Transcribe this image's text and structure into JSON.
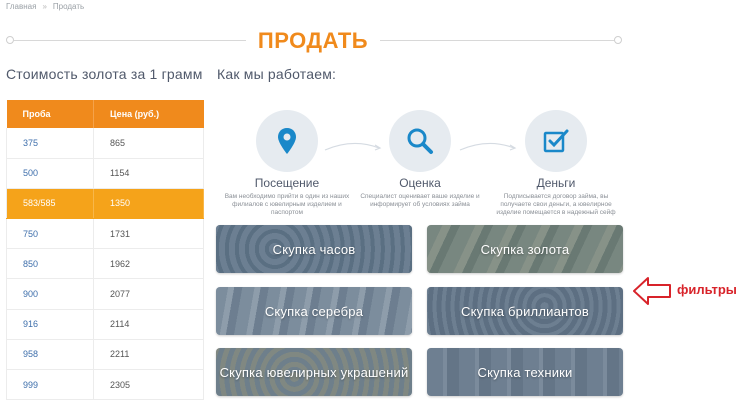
{
  "breadcrumb": {
    "home": "Главная",
    "separator": "»",
    "current": "Продать"
  },
  "page": {
    "title": "ПРОДАТЬ"
  },
  "gold_table": {
    "heading": "Стоимость золота за 1 грамм",
    "columns": [
      "Проба",
      "Цена (руб.)"
    ],
    "rows": [
      {
        "probe": "375",
        "price": "865"
      },
      {
        "probe": "500",
        "price": "1154"
      },
      {
        "probe": "583/585",
        "price": "1350",
        "highlighted": true
      },
      {
        "probe": "750",
        "price": "1731"
      },
      {
        "probe": "850",
        "price": "1962"
      },
      {
        "probe": "900",
        "price": "2077"
      },
      {
        "probe": "916",
        "price": "2114"
      },
      {
        "probe": "958",
        "price": "2211"
      },
      {
        "probe": "999",
        "price": "2305"
      }
    ]
  },
  "how_we_work": {
    "heading": "Как мы работаем:",
    "steps": [
      {
        "name": "Посещение",
        "icon": "map-pin-icon",
        "desc_line1": "Вам необходимо прийти в один из наших",
        "desc_line2": "филиалов с ювелирным изделием и",
        "desc_line3": "паспортом"
      },
      {
        "name": "Оценка",
        "icon": "magnifier-icon",
        "desc_line1": "Специалист оценивает ваше изделие и",
        "desc_line2": "информирует об условиях займа",
        "desc_line3": ""
      },
      {
        "name": "Деньги",
        "icon": "checkbox-icon",
        "desc_line1": "Подписывается договор займа, вы",
        "desc_line2": "получаете свои деньги, а ювелирное",
        "desc_line3": "изделие помещается в надежный сейф"
      }
    ]
  },
  "categories": [
    {
      "label": "Скупка часов"
    },
    {
      "label": "Скупка золота"
    },
    {
      "label": "Скупка серебра"
    },
    {
      "label": "Скупка бриллиантов"
    },
    {
      "label": "Скупка ювелирных украшений"
    },
    {
      "label": "Скупка техники"
    }
  ],
  "annotation": {
    "label": "фильтры"
  },
  "colors": {
    "accent": "#f08a1c",
    "highlight_row": "#f5a31a",
    "link": "#3d6eab",
    "icon": "#1a88c9",
    "annotation": "#d8232a"
  }
}
